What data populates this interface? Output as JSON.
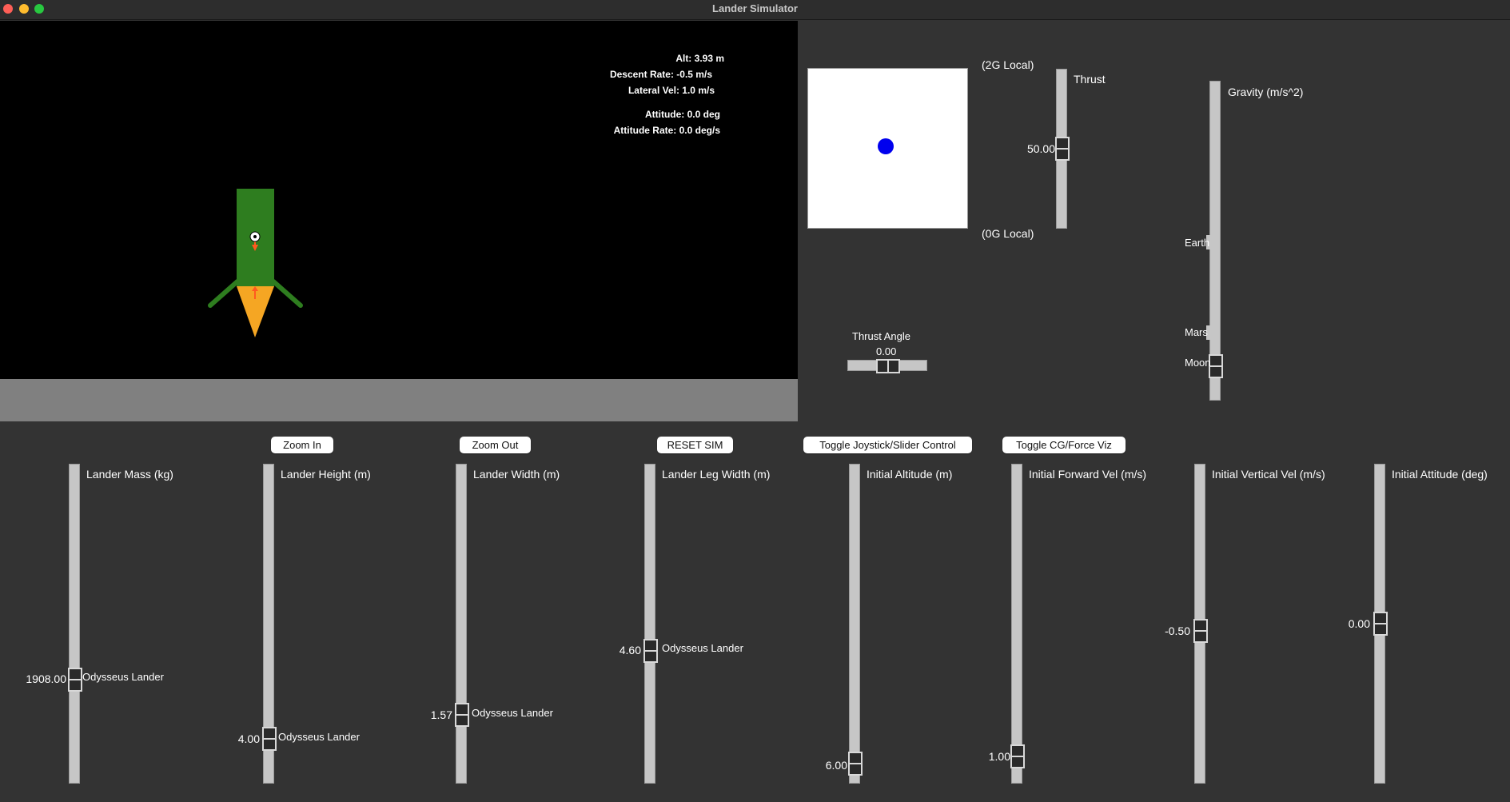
{
  "window": {
    "title": "Lander Simulator"
  },
  "telemetry": {
    "alt": "Alt: 3.93 m",
    "descent_rate": "Descent Rate: -0.5 m/s",
    "lateral_vel": "Lateral Vel: 1.0 m/s",
    "attitude": "Attitude: 0.0 deg",
    "attitude_rate": "Attitude Rate: 0.0 deg/s"
  },
  "colors": {
    "lander_body": "#2e7d1f",
    "flame": "#f5a623",
    "force_arrow": "#ff5a1f",
    "joystick_dot": "#0000ee",
    "ground": "#808080"
  },
  "joystick": {
    "top_label": "(2G Local)",
    "bottom_label": "(0G Local)"
  },
  "thrust": {
    "label": "Thrust",
    "value": "50.00"
  },
  "thrust_angle": {
    "label": "Thrust Angle",
    "value": "0.00"
  },
  "gravity": {
    "label": "Gravity (m/s^2)",
    "presets": [
      "Earth",
      "Mars",
      "Moon"
    ]
  },
  "buttons": {
    "zoom_in": "Zoom In",
    "zoom_out": "Zoom Out",
    "reset": "RESET SIM",
    "toggle_control": "Toggle Joystick/Slider Control",
    "toggle_viz": "Toggle CG/Force Viz"
  },
  "sliders": {
    "mass": {
      "label": "Lander Mass (kg)",
      "value": "1908.00",
      "preset": "Odysseus Lander"
    },
    "height": {
      "label": "Lander Height (m)",
      "value": "4.00",
      "preset": "Odysseus Lander"
    },
    "width": {
      "label": "Lander Width (m)",
      "value": "1.57",
      "preset": "Odysseus Lander"
    },
    "leg_width": {
      "label": "Lander Leg Width (m)",
      "value": "4.60",
      "preset": "Odysseus Lander"
    },
    "init_alt": {
      "label": "Initial Altitude (m)",
      "value": "6.00"
    },
    "init_fwd": {
      "label": "Initial Forward Vel (m/s)",
      "value": "1.00"
    },
    "init_vert": {
      "label": "Initial Vertical Vel (m/s)",
      "value": "-0.50"
    },
    "init_att": {
      "label": "Initial Attitude (deg)",
      "value": "0.00"
    }
  }
}
